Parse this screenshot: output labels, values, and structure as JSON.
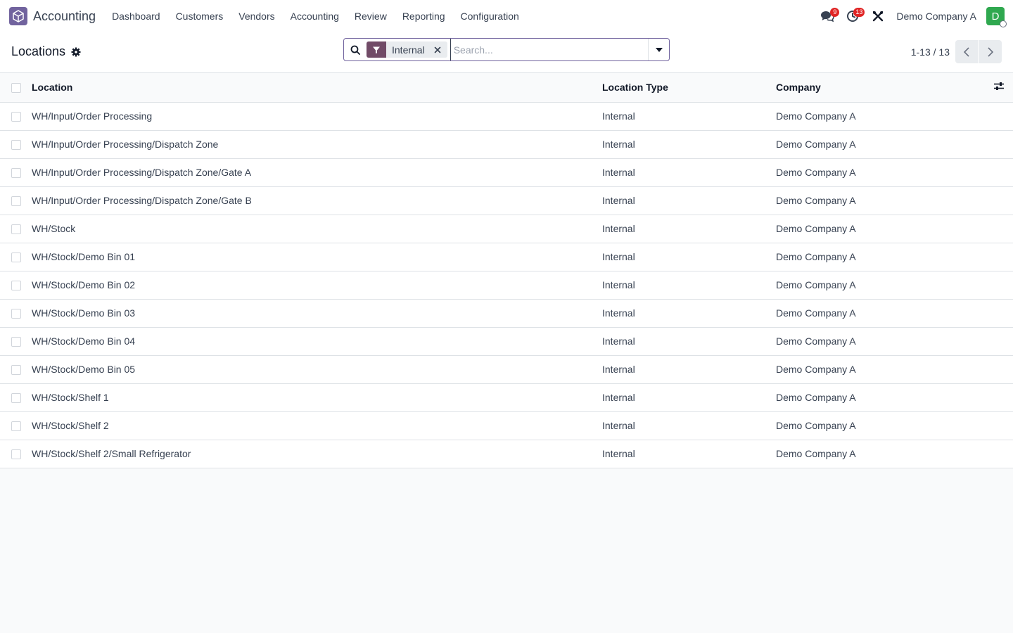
{
  "navbar": {
    "app_name": "Accounting",
    "menu": [
      "Dashboard",
      "Customers",
      "Vendors",
      "Accounting",
      "Review",
      "Reporting",
      "Configuration"
    ],
    "messages_count": "9",
    "activities_count": "13",
    "company": "Demo Company A",
    "avatar_initial": "D"
  },
  "control_panel": {
    "title": "Locations",
    "facet_value": "Internal",
    "search_placeholder": "Search...",
    "pager": "1-13 / 13"
  },
  "table": {
    "headers": {
      "location": "Location",
      "type": "Location Type",
      "company": "Company"
    },
    "rows": [
      {
        "location": "WH/Input/Order Processing",
        "type": "Internal",
        "company": "Demo Company A"
      },
      {
        "location": "WH/Input/Order Processing/Dispatch Zone",
        "type": "Internal",
        "company": "Demo Company A"
      },
      {
        "location": "WH/Input/Order Processing/Dispatch Zone/Gate A",
        "type": "Internal",
        "company": "Demo Company A"
      },
      {
        "location": "WH/Input/Order Processing/Dispatch Zone/Gate B",
        "type": "Internal",
        "company": "Demo Company A"
      },
      {
        "location": "WH/Stock",
        "type": "Internal",
        "company": "Demo Company A"
      },
      {
        "location": "WH/Stock/Demo Bin 01",
        "type": "Internal",
        "company": "Demo Company A"
      },
      {
        "location": "WH/Stock/Demo Bin 02",
        "type": "Internal",
        "company": "Demo Company A"
      },
      {
        "location": "WH/Stock/Demo Bin 03",
        "type": "Internal",
        "company": "Demo Company A"
      },
      {
        "location": "WH/Stock/Demo Bin 04",
        "type": "Internal",
        "company": "Demo Company A"
      },
      {
        "location": "WH/Stock/Demo Bin 05",
        "type": "Internal",
        "company": "Demo Company A"
      },
      {
        "location": "WH/Stock/Shelf 1",
        "type": "Internal",
        "company": "Demo Company A"
      },
      {
        "location": "WH/Stock/Shelf 2",
        "type": "Internal",
        "company": "Demo Company A"
      },
      {
        "location": "WH/Stock/Shelf 2/Small Refrigerator",
        "type": "Internal",
        "company": "Demo Company A"
      }
    ]
  },
  "colors": {
    "brand": "#714b67",
    "accent": "#71639e",
    "badge": "#e02424",
    "avatar": "#2fa84f"
  }
}
